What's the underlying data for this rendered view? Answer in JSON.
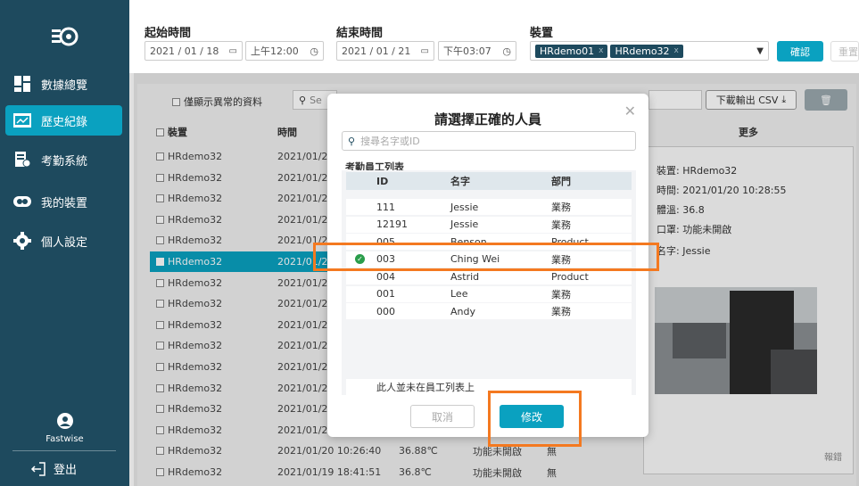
{
  "sidebar": {
    "items": [
      {
        "label": "數據總覽",
        "icon": "dashboard-icon"
      },
      {
        "label": "歷史紀錄",
        "icon": "history-icon",
        "active": true
      },
      {
        "label": "考勤系統",
        "icon": "attendance-icon"
      },
      {
        "label": "我的裝置",
        "icon": "device-icon"
      },
      {
        "label": "個人設定",
        "icon": "gear-icon"
      }
    ],
    "user_label": "Fastwise",
    "logout_label": "登出"
  },
  "filters": {
    "start_label": "起始時間",
    "start_date": "2021 / 01 / 18",
    "start_time": "上午12:00",
    "end_label": "結束時間",
    "end_date": "2021 / 01 / 21",
    "end_time": "下午03:07",
    "device_label": "裝置",
    "device_tags": [
      "HRdemo01",
      "HRdemo32"
    ],
    "confirm_label": "確認",
    "reset_label": "重置"
  },
  "toolbar": {
    "abnormal_only_label": "僅顯示異常的資料",
    "search_placeholder": "Se",
    "csv_label": "下載輸出 CSV"
  },
  "table": {
    "headers": {
      "device": "裝置",
      "time": "時間",
      "more": "更多"
    },
    "rows": [
      {
        "device": "HRdemo32",
        "time": "2021/01/20",
        "selected": false
      },
      {
        "device": "HRdemo32",
        "time": "2021/01/20",
        "selected": false
      },
      {
        "device": "HRdemo32",
        "time": "2021/01/20",
        "selected": false
      },
      {
        "device": "HRdemo32",
        "time": "2021/01/20",
        "selected": false
      },
      {
        "device": "HRdemo32",
        "time": "2021/01/20",
        "selected": false
      },
      {
        "device": "HRdemo32",
        "time": "2021/01/20",
        "selected": true
      },
      {
        "device": "HRdemo32",
        "time": "2021/01/20",
        "selected": false
      },
      {
        "device": "HRdemo32",
        "time": "2021/01/20",
        "selected": false
      },
      {
        "device": "HRdemo32",
        "time": "2021/01/20",
        "selected": false
      },
      {
        "device": "HRdemo32",
        "time": "2021/01/20",
        "selected": false
      },
      {
        "device": "HRdemo32",
        "time": "2021/01/20",
        "selected": false
      },
      {
        "device": "HRdemo32",
        "time": "2021/01/20",
        "selected": false
      },
      {
        "device": "HRdemo32",
        "time": "2021/01/20",
        "selected": false
      },
      {
        "device": "HRdemo32",
        "time": "2021/01/20",
        "selected": false
      },
      {
        "device": "HRdemo32",
        "time": "2021/01/20 10:26:40",
        "temp": "36.88℃",
        "mask": "功能未開啟",
        "abnormal": "無",
        "selected": false
      },
      {
        "device": "HRdemo32",
        "time": "2021/01/19 18:41:51",
        "temp": "36.8℃",
        "mask": "功能未開啟",
        "abnormal": "無",
        "selected": false
      }
    ]
  },
  "detail": {
    "device_line": "裝置: HRdemo32",
    "time_line": "時間: 2021/01/20 10:28:55",
    "temp_line": "體溫: 36.8",
    "mask_line": "口罩: 功能未開啟",
    "name_line": "名字: Jessie",
    "report_label": "報錯"
  },
  "modal": {
    "title": "請選擇正確的人員",
    "search_placeholder": "搜尋名字或ID",
    "list_title": "考勤員工列表",
    "headers": {
      "id": "ID",
      "name": "名字",
      "dept": "部門"
    },
    "employees": [
      {
        "id": "111",
        "name": "Jessie",
        "dept": "業務"
      },
      {
        "id": "12191",
        "name": "Jessie",
        "dept": "業務"
      },
      {
        "id": "005",
        "name": "Benson",
        "dept": "Product"
      },
      {
        "id": "003",
        "name": "Ching Wei",
        "dept": "業務",
        "selected": true
      },
      {
        "id": "004",
        "name": "Astrid",
        "dept": "Product"
      },
      {
        "id": "001",
        "name": "Lee",
        "dept": "業務"
      },
      {
        "id": "000",
        "name": "Andy",
        "dept": "業務"
      }
    ],
    "not_in_list_label": "此人並未在員工列表上",
    "cancel_label": "取消",
    "modify_label": "修改"
  },
  "colors": {
    "sidebar": "#1e4a5e",
    "accent": "#0aa1c0",
    "highlight": "#f47920"
  }
}
